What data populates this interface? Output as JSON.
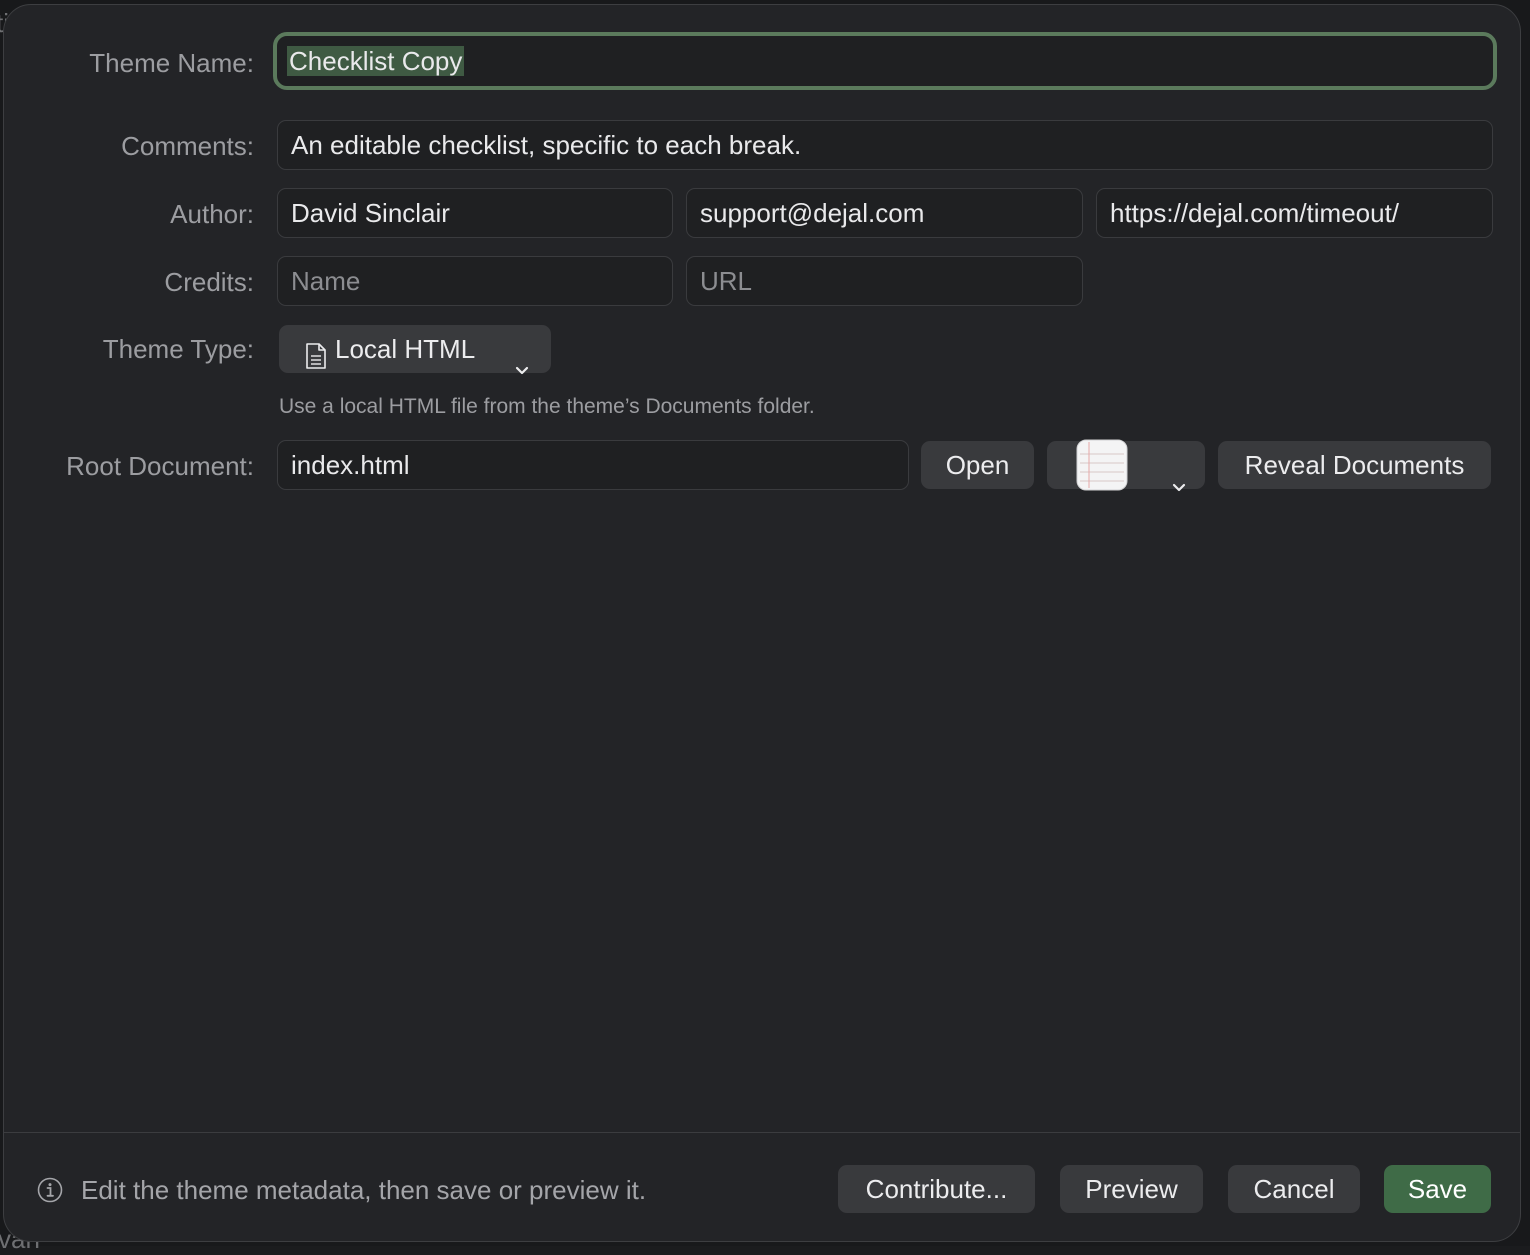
{
  "backdrop": {
    "fragment_top": "ti",
    "fragment_bottom": "van"
  },
  "form": {
    "theme_name": {
      "label": "Theme Name:",
      "value": "Checklist Copy"
    },
    "comments": {
      "label": "Comments:",
      "value": "An editable checklist, specific to each break."
    },
    "author": {
      "label": "Author:",
      "name_value": "David Sinclair",
      "email_value": "support@dejal.com",
      "url_value": "https://dejal.com/timeout/"
    },
    "credits": {
      "label": "Credits:",
      "name_placeholder": "Name",
      "url_placeholder": "URL"
    },
    "theme_type": {
      "label": "Theme Type:",
      "selected": "Local HTML",
      "icon": "document-icon",
      "help_text": "Use a local HTML file from the theme’s Documents folder."
    },
    "root_document": {
      "label": "Root Document:",
      "value": "index.html",
      "open_label": "Open",
      "app_icon": "textedit-icon",
      "reveal_label": "Reveal Documents"
    }
  },
  "footer": {
    "info_icon": "info-icon",
    "message": "Edit the theme metadata, then save or preview it.",
    "contribute_label": "Contribute...",
    "preview_label": "Preview",
    "cancel_label": "Cancel",
    "save_label": "Save"
  },
  "colors": {
    "accent": "#3f6b47",
    "focus_ring": "#5b7a5c",
    "selection": "#3f5a43",
    "sheet_bg": "#232427"
  }
}
